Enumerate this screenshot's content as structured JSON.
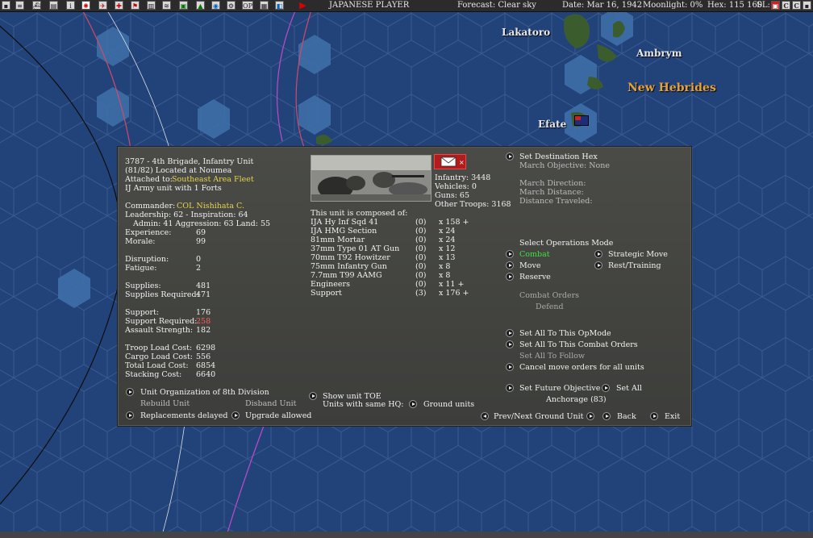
{
  "topbar": {
    "player": "JAPANESE PLAYER",
    "forecast": "Forecast: Clear sky",
    "date": "Date: Mar 16, 1942",
    "moonlight": "Moonlight: 0%",
    "hex": "Hex: 115 160",
    "sl": "SL:",
    "op_icon": "OP",
    "tool_icons": [
      "window-icon",
      "list-icon",
      "ships-icon",
      "report-icon",
      "info-icon",
      "rising-sun-icon",
      "plane-icon",
      "target-icon",
      "flag-icon",
      "bars-icon",
      "sliders-icon",
      "base-icon",
      "unit-icon",
      "globe-icon",
      "settings-icon",
      "op-icon",
      "view-icon",
      "map-icon",
      "play-icon"
    ]
  },
  "map": {
    "labels": {
      "lakatoro": "Lakatoro",
      "ambrym": "Ambrym",
      "new_hebrides": "New Hebrides",
      "efate": "Efate"
    }
  },
  "unit": {
    "title": "3787 - 4th Brigade, Infantry Unit",
    "location": "(81/82) Located at Noumea",
    "attached_label": "Attached to:",
    "attached_value": "Southeast Area Fleet",
    "army_line": "IJ Army unit with 1 Forts",
    "commander_label": "Commander:",
    "commander_value": "COL Nishihata C.",
    "leadership_line": "Leadership: 62 - Inspiration: 64",
    "admin_line": "Admin: 41  Aggression: 63  Land: 55",
    "stats": [
      {
        "label": "Experience:",
        "value": "69"
      },
      {
        "label": "Morale:",
        "value": "99"
      },
      {
        "label": "Disruption:",
        "value": "0"
      },
      {
        "label": "Fatigue:",
        "value": "2"
      },
      {
        "label": "Supplies:",
        "value": "481"
      },
      {
        "label": "Supplies Required:",
        "value": "471"
      },
      {
        "label": "Support:",
        "value": "176"
      },
      {
        "label": "Support Required:",
        "value": "258"
      },
      {
        "label": "Assault Strength:",
        "value": "182"
      },
      {
        "label": "Troop Load Cost:",
        "value": "6298"
      },
      {
        "label": "Cargo Load Cost:",
        "value": "556"
      },
      {
        "label": "Total Load Cost:",
        "value": "6854"
      },
      {
        "label": "Stacking Cost:",
        "value": "6640"
      }
    ],
    "unit_org": "Unit Organization of 8th Division",
    "rebuild": "Rebuild Unit",
    "disband": "Disband Unit",
    "replacements": "Replacements delayed",
    "upgrade": "Upgrade allowed"
  },
  "composition": {
    "infantry": "Infantry: 3448",
    "vehicles": "Vehicles: 0",
    "guns": "Guns: 65",
    "other": "Other Troops: 3168",
    "header": "This unit is composed of:",
    "rows": [
      {
        "name": "IJA Hy Inf Sqd 41",
        "paren": "(0)",
        "count": "x 158 +"
      },
      {
        "name": "IJA HMG Section",
        "paren": "(0)",
        "count": "x 24"
      },
      {
        "name": "81mm Mortar",
        "paren": "(0)",
        "count": "x 24"
      },
      {
        "name": "37mm Type 01 AT Gun",
        "paren": "(0)",
        "count": "x 12"
      },
      {
        "name": "70mm T92 Howitzer",
        "paren": "(0)",
        "count": "x 13"
      },
      {
        "name": "75mm Infantry Gun",
        "paren": "(0)",
        "count": "x 8"
      },
      {
        "name": "7.7mm T99 AAMG",
        "paren": "(0)",
        "count": "x 8"
      },
      {
        "name": "Engineers",
        "paren": "(0)",
        "count": "x 11 +"
      },
      {
        "name": "Support",
        "paren": "(3)",
        "count": "x 176 +"
      }
    ],
    "show_toe": "Show unit TOE",
    "same_hq": "Units with same HQ:",
    "ground_units": "Ground units"
  },
  "orders": {
    "set_destination": "Set Destination Hex",
    "march_objective": "March Objective: None",
    "march_direction": "March Direction:",
    "march_distance": "March Distance:",
    "distance_traveled": "Distance Traveled:",
    "select_ops": "Select Operations Mode",
    "combat": "Combat",
    "strategic_move": "Strategic Move",
    "move": "Move",
    "rest_training": "Rest/Training",
    "reserve": "Reserve",
    "combat_orders": "Combat Orders",
    "defend": "Defend",
    "set_all_opmode": "Set All To This OpMode",
    "set_all_combat": "Set All To This Combat Orders",
    "set_all_follow": "Set All To Follow",
    "cancel_move": "Cancel move orders for all units",
    "set_future": "Set Future Objective",
    "set_all": "Set All",
    "anchorage": "Anchorage (83)",
    "prev_next": "Prev/Next Ground Unit",
    "back": "Back",
    "exit": "Exit"
  }
}
